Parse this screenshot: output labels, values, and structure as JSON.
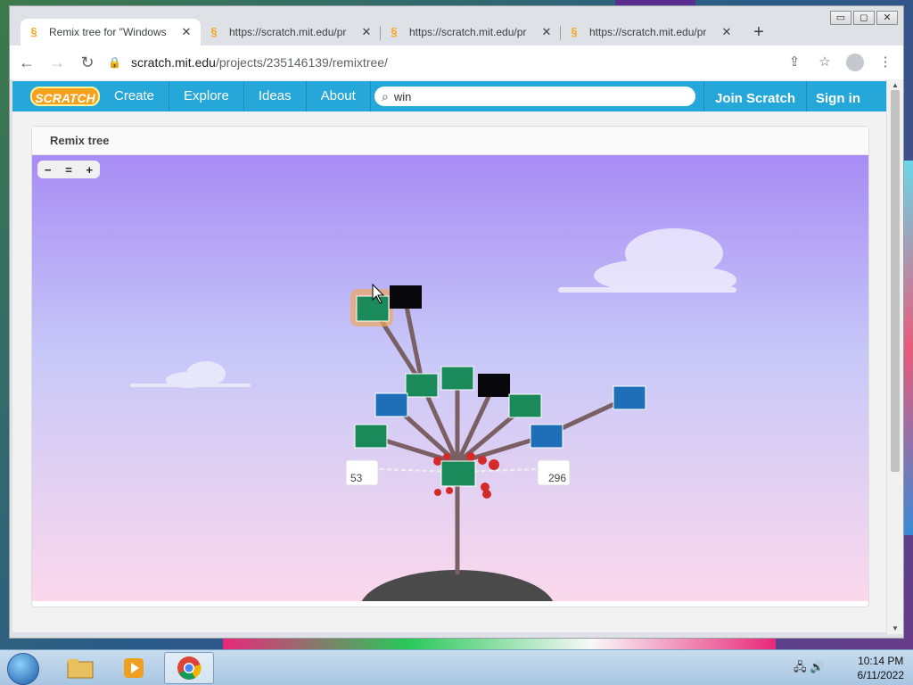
{
  "browser": {
    "tabs": [
      {
        "title": "Remix tree for \"Windows",
        "active": true
      },
      {
        "title": "https://scratch.mit.edu/pr",
        "active": false
      },
      {
        "title": "https://scratch.mit.edu/pr",
        "active": false
      },
      {
        "title": "https://scratch.mit.edu/pr",
        "active": false
      }
    ],
    "new_tab": "+",
    "url_host": "scratch.mit.edu",
    "url_path": "/projects/235146139/remixtree/",
    "window_controls": [
      "▭",
      "◻",
      "✕"
    ]
  },
  "site": {
    "logo": "SCRATCH",
    "nav": [
      "Create",
      "Explore",
      "Ideas",
      "About"
    ],
    "search_value": "win",
    "join": "Join Scratch",
    "signin": "Sign in"
  },
  "remix": {
    "header": "Remix tree",
    "zoom": [
      "−",
      "=",
      "+"
    ],
    "left_count": "53",
    "right_count": "296",
    "colors": {
      "branch": "#7a5f63",
      "ground": "#4a4a4a",
      "thumb_green": "#1a8a5a",
      "thumb_blue": "#1e6fb8",
      "thumb_dark": "#08080c",
      "heart": "#d42a2a",
      "highlight": "#f0a860"
    }
  },
  "taskbar": {
    "time": "10:14 PM",
    "date": "6/11/2022"
  }
}
